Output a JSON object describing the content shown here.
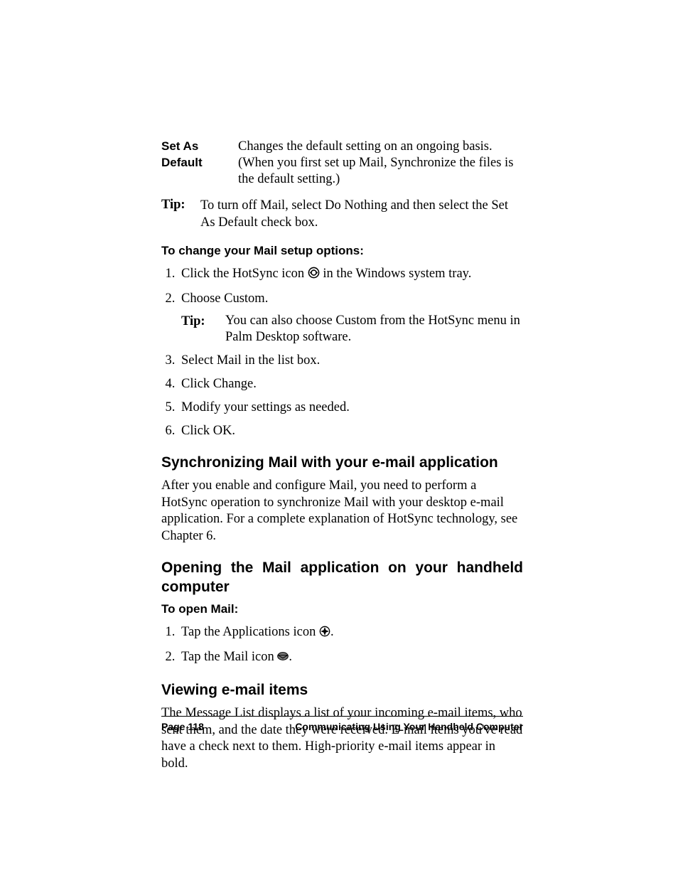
{
  "definition": {
    "term_line1": "Set As",
    "term_line2": "Default",
    "desc": "Changes the default setting on an ongoing basis. (When you first set up Mail, Synchronize the files is the default setting.)"
  },
  "tip1": {
    "label": "Tip:",
    "body": "To turn off Mail, select Do Nothing and then select the Set As Default check box."
  },
  "change_heading": "To change your Mail setup options:",
  "steps1": {
    "s1a": "Click the HotSync icon ",
    "s1b": " in the Windows system tray.",
    "s2": "Choose Custom.",
    "s2_tip_label": "Tip:",
    "s2_tip_body": "You can also choose Custom from the HotSync menu in Palm Desktop software.",
    "s3": "Select Mail in the list box.",
    "s4": "Click Change.",
    "s5": "Modify your settings as needed.",
    "s6": "Click OK."
  },
  "h2_sync": "Synchronizing Mail with your e-mail application",
  "p_sync": "After you enable and configure Mail, you need to perform a HotSync operation to synchronize Mail with your desktop e-mail application. For a complete explanation of HotSync technology, see Chapter 6.",
  "h2_open": "Opening the Mail application on your handheld computer",
  "open_heading": "To open Mail:",
  "steps2": {
    "s1a": "Tap the Applications icon ",
    "s1b": ".",
    "s2a": "Tap the Mail icon ",
    "s2b": "."
  },
  "h2_view": "Viewing e-mail items",
  "p_view": "The Message List displays a list of your incoming e-mail items, who sent them, and the date they were received. E-mail items you've read have a check next to them. High-priority e-mail items appear in bold.",
  "footer": {
    "page": "Page 118",
    "title": "Communicating Using Your Handheld Computer"
  }
}
